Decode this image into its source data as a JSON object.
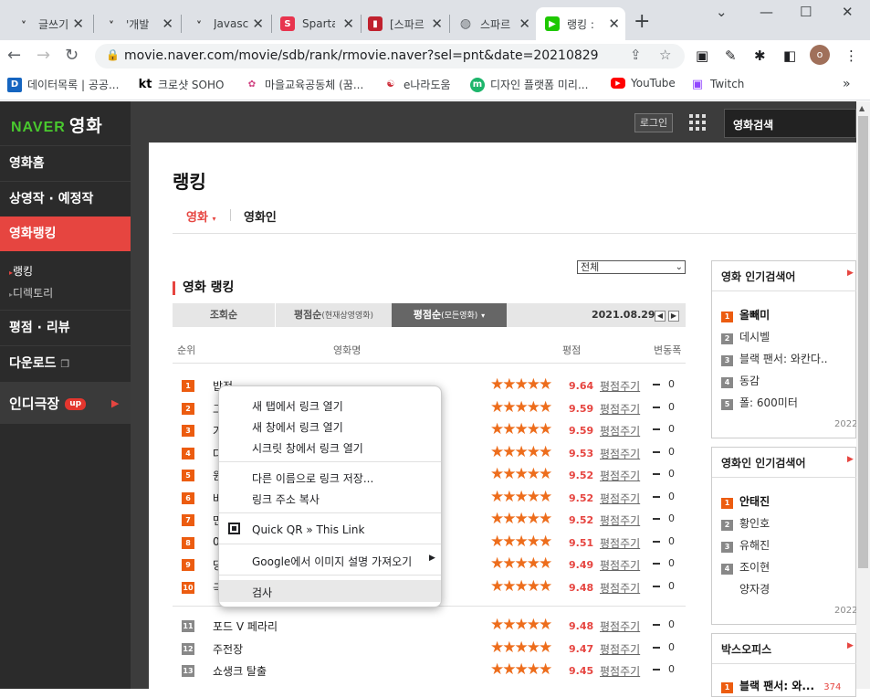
{
  "browser": {
    "tabs": [
      {
        "title": "글쓰기",
        "icon": "velog"
      },
      {
        "title": "'개발",
        "icon": "velog"
      },
      {
        "title": "Javasc",
        "icon": "velog"
      },
      {
        "title": "Sparta",
        "icon": "sparta"
      },
      {
        "title": "[스파르",
        "icon": "notion"
      },
      {
        "title": "스파르",
        "icon": "globe"
      },
      {
        "title": "랭킹 : ",
        "icon": "naver-movie",
        "active": true
      }
    ],
    "url": "movie.naver.com/movie/sdb/rank/rmovie.naver?sel=pnt&date=20210829",
    "profile_initial": "o",
    "bookmarks": [
      {
        "label": "데이터목록 | 공공...",
        "icon": "D"
      },
      {
        "label": "크로샷 SOHO",
        "icon": "kt"
      },
      {
        "label": "마을교육공동체 (꿈...",
        "icon": "m"
      },
      {
        "label": "e나라도움",
        "icon": "e"
      },
      {
        "label": "디자인 플랫폼 미리...",
        "icon": "m"
      },
      {
        "label": "YouTube",
        "icon": "yt"
      },
      {
        "label": "Twitch",
        "icon": "tw"
      }
    ]
  },
  "site": {
    "logo_naver": "NAVER",
    "logo_movie": "영화",
    "login": "로그인",
    "search_placeholder": "영화검색",
    "sidebar": [
      {
        "label": "영화홈"
      },
      {
        "label": "상영작 · 예정작"
      },
      {
        "label": "영화랭킹",
        "active": true
      },
      {
        "label": "평점 · 리뷰"
      },
      {
        "label": "다운로드"
      },
      {
        "label": "인디극장",
        "badge": "up"
      }
    ],
    "sidebar_sub": [
      "랭킹",
      "디렉토리"
    ]
  },
  "page": {
    "title": "랭킹",
    "subtabs": [
      "영화",
      "영화인"
    ],
    "select_value": "전체",
    "section_title": "영화 랭킹",
    "sort_tabs": [
      {
        "label": "조회순",
        "sub": ""
      },
      {
        "label": "평점순",
        "sub": "(현재상영영화)"
      },
      {
        "label": "평점순",
        "sub": "(모든영화)",
        "active": true
      }
    ],
    "date": "2021.08.29",
    "columns": [
      "순위",
      "영화명",
      "평점",
      "변동폭"
    ],
    "rows": [
      {
        "rank": "1",
        "title": "밥정",
        "score": "9.64",
        "rate": "평점주기",
        "change": "0"
      },
      {
        "rank": "2",
        "title": "그",
        "score": "9.59",
        "rate": "평점주기",
        "change": "0"
      },
      {
        "rank": "3",
        "title": "가",
        "score": "9.59",
        "rate": "평점주기",
        "change": "0"
      },
      {
        "rank": "4",
        "title": "다",
        "score": "9.53",
        "rate": "평점주기",
        "change": "0"
      },
      {
        "rank": "5",
        "title": "원",
        "score": "9.52",
        "rate": "평점주기",
        "change": "0"
      },
      {
        "rank": "6",
        "title": "바",
        "score": "9.52",
        "rate": "평점주기",
        "change": "0"
      },
      {
        "rank": "7",
        "title": "먼",
        "score": "9.52",
        "rate": "평점주기",
        "change": "0"
      },
      {
        "rank": "8",
        "title": "0",
        "score": "9.51",
        "rate": "평점주기",
        "change": "0"
      },
      {
        "rank": "9",
        "title": "당",
        "score": "9.49",
        "rate": "평점주기",
        "change": "0"
      },
      {
        "rank": "10",
        "title": "극",
        "score": "9.48",
        "rate": "평점주기",
        "change": "0"
      },
      {
        "rank": "11",
        "title": "포드 V 페라리",
        "score": "9.48",
        "rate": "평점주기",
        "change": "0"
      },
      {
        "rank": "12",
        "title": "주전장",
        "score": "9.47",
        "rate": "평점주기",
        "change": "0"
      },
      {
        "rank": "13",
        "title": "쇼생크 탈출",
        "score": "9.45",
        "rate": "평점주기",
        "change": "0"
      }
    ],
    "stars": "★★★★★"
  },
  "right": {
    "box1": {
      "title": "영화 인기검색어",
      "year": "2022",
      "items": [
        "올빼미",
        "데시벨",
        "블랙 팬서: 와칸다..",
        "동감",
        "폴: 600미터"
      ]
    },
    "box2": {
      "title": "영화인 인기검색어",
      "year": "2022",
      "items": [
        "안태진",
        "황인호",
        "유해진",
        "조이현",
        "양자경"
      ]
    },
    "box3": {
      "title": "박스오피스",
      "items": [
        "블랙 팬서: 와...",
        "374"
      ]
    }
  },
  "context_menu": {
    "items": [
      "새 탭에서 링크 열기",
      "새 창에서 링크 열기",
      "시크릿 창에서 링크 열기",
      "다른 이름으로 링크 저장...",
      "링크 주소 복사",
      "Quick QR » This Link",
      "Google에서 이미지 설명 가져오기",
      "검사"
    ]
  },
  "colors": {
    "accent": "#e64540",
    "brand_green": "#49c82e",
    "star": "#ed6d1c"
  }
}
